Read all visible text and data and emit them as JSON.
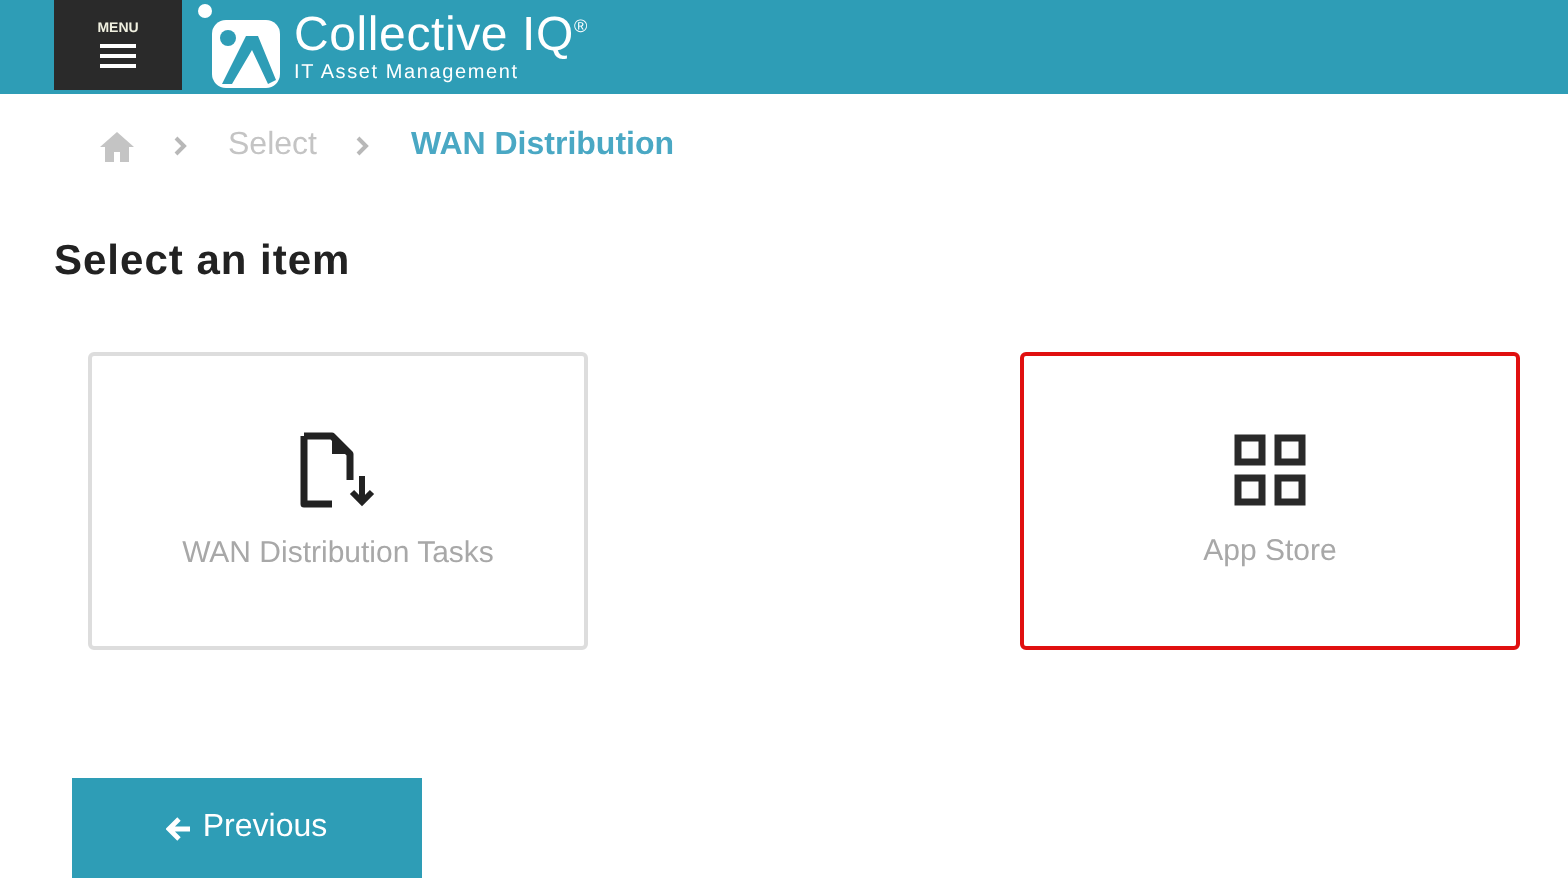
{
  "header": {
    "menu_label": "MENU",
    "brand": "Collective IQ$^{®}$",
    "tagline": "IT Asset Management"
  },
  "breadcrumbs": [
    {
      "label": "Select",
      "current": false
    },
    {
      "label": "WAN Distribution",
      "current": true
    }
  ],
  "title": "Select an item",
  "items": [
    {
      "kind": "file-download",
      "label": "WAN Distribution Tasks",
      "selected": false
    },
    {
      "kind": "grid",
      "label": "App Store",
      "selected": true
    }
  ],
  "buttons": [
    {
      "kind": "previous",
      "label": "Previous"
    }
  ]
}
